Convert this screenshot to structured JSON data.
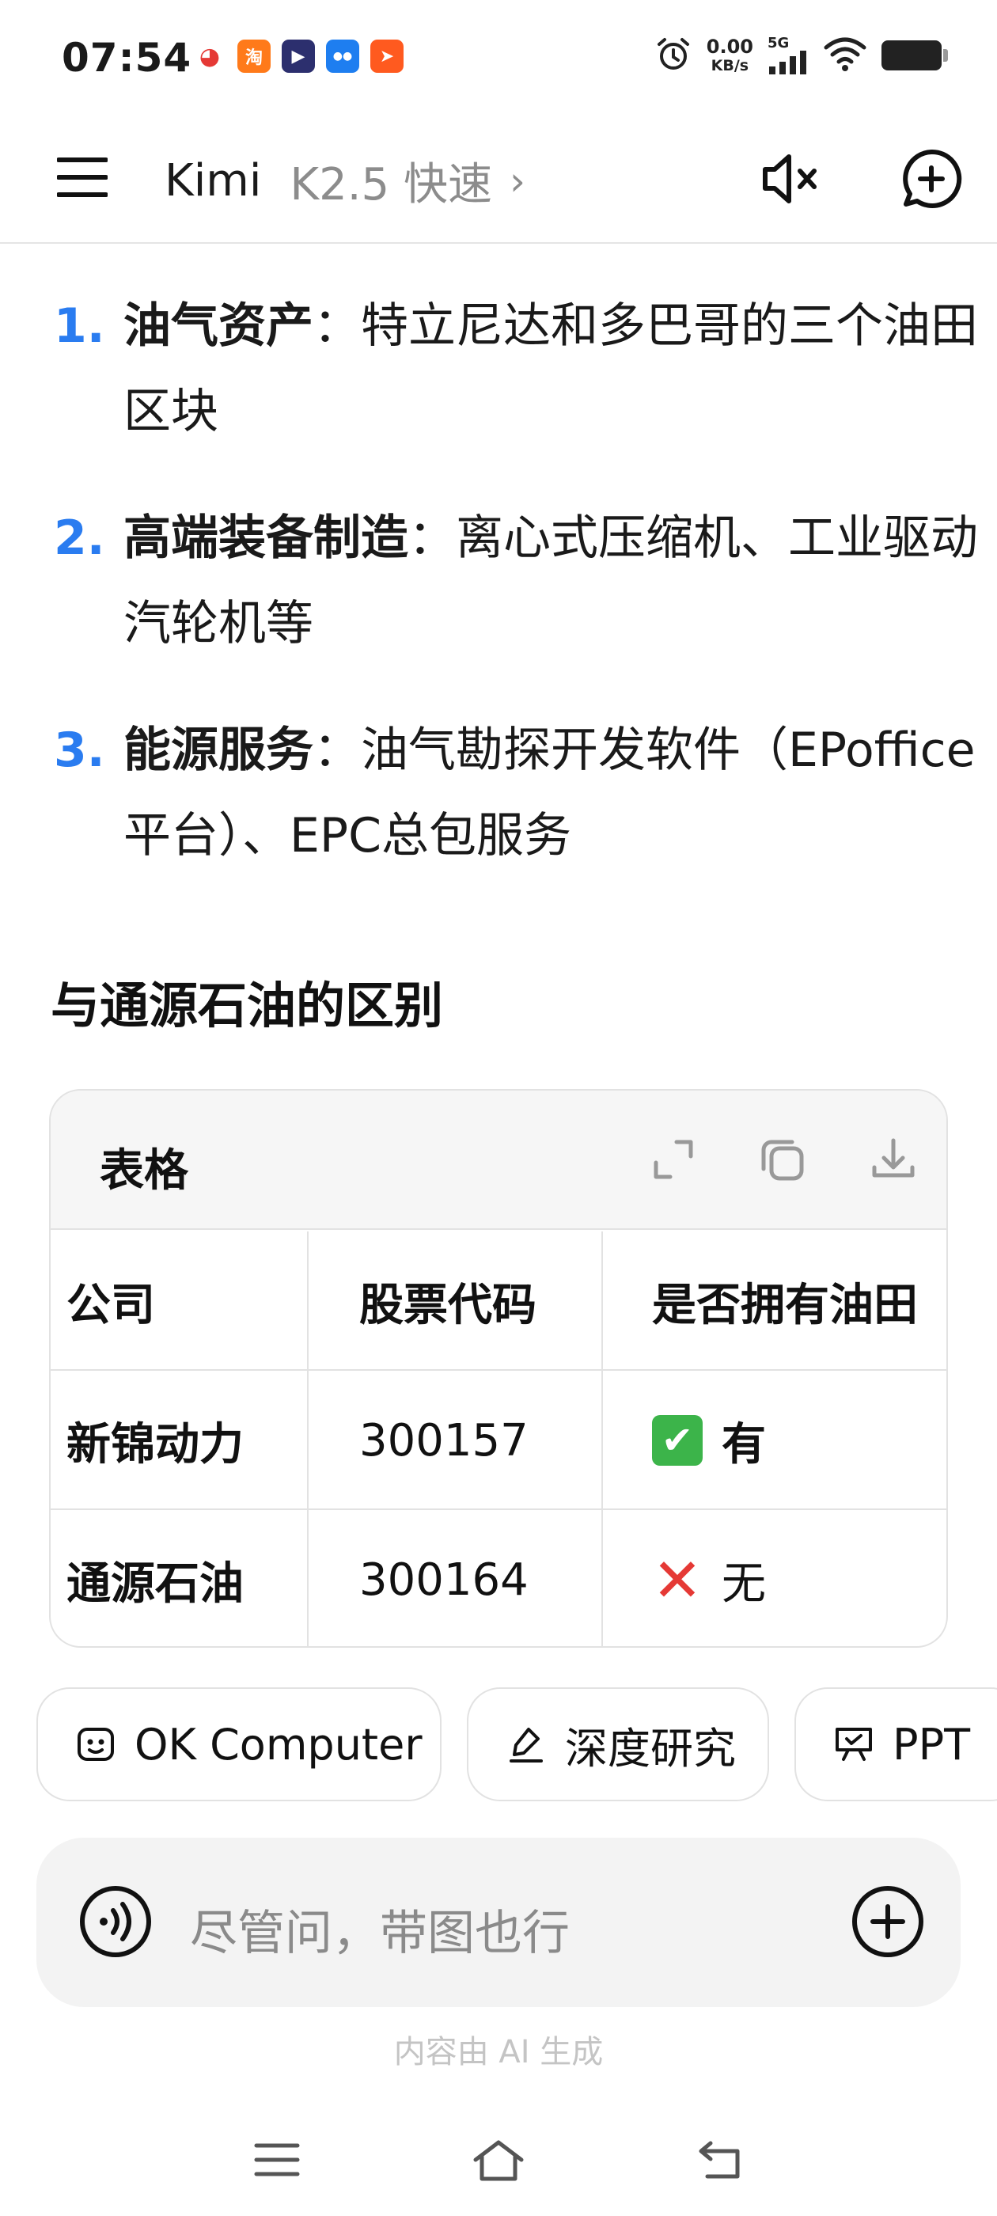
{
  "status_bar": {
    "time": "07:54",
    "app_icons": [
      {
        "name": "weibo-icon",
        "glyph": "◕",
        "color": "#ffffff",
        "fg": "#e53935"
      },
      {
        "name": "taobao-icon",
        "glyph": "淘",
        "color": "#ff7a1a",
        "fg": "#ffffff"
      },
      {
        "name": "play-app-icon",
        "glyph": "▶",
        "color": "#2c2f6e",
        "fg": "#ffffff"
      },
      {
        "name": "owl-app-icon",
        "glyph": "●●",
        "color": "#1e7ef0",
        "fg": "#ffffff"
      },
      {
        "name": "send-app-icon",
        "glyph": "➤",
        "color": "#ff5a1f",
        "fg": "#ffffff"
      }
    ],
    "net_speed_value": "0.00",
    "net_speed_unit": "KB/s",
    "signal_label": "5G"
  },
  "header": {
    "app_name": "Kimi",
    "model": "K2.5 快速",
    "chevron": "›"
  },
  "content": {
    "list": [
      {
        "num": "1.",
        "bold": "油气资产",
        "rest": "：特立尼达和多巴哥的三个油田区块"
      },
      {
        "num": "2.",
        "bold": "高端装备制造",
        "rest": "：离心式压缩机、工业驱动汽轮机等"
      },
      {
        "num": "3.",
        "bold": "能源服务",
        "rest": "：油气勘探开发软件（EPoffice平台）、EPC总包服务"
      }
    ],
    "section_heading": "与通源石油的区别"
  },
  "table": {
    "label": "表格",
    "columns": [
      "公司",
      "股票代码",
      "是否拥有油田"
    ],
    "rows": [
      {
        "company": "新锦动力",
        "code": "300157",
        "has_oilfield": "有",
        "mark": "✔"
      },
      {
        "company": "通源石油",
        "code": "300164",
        "has_oilfield": "无",
        "mark": "✕"
      }
    ]
  },
  "chips": [
    {
      "label": "OK Computer",
      "icon": "robot-icon"
    },
    {
      "label": "深度研究",
      "icon": "research-icon"
    },
    {
      "label": "PPT",
      "icon": "presentation-icon"
    }
  ],
  "input": {
    "placeholder": "尽管问，带图也行"
  },
  "disclaimer": "内容由 AI 生成",
  "colors": {
    "accent_blue": "#2a7cf0",
    "check_green": "#3cb44a",
    "cross_red": "#e53935"
  }
}
